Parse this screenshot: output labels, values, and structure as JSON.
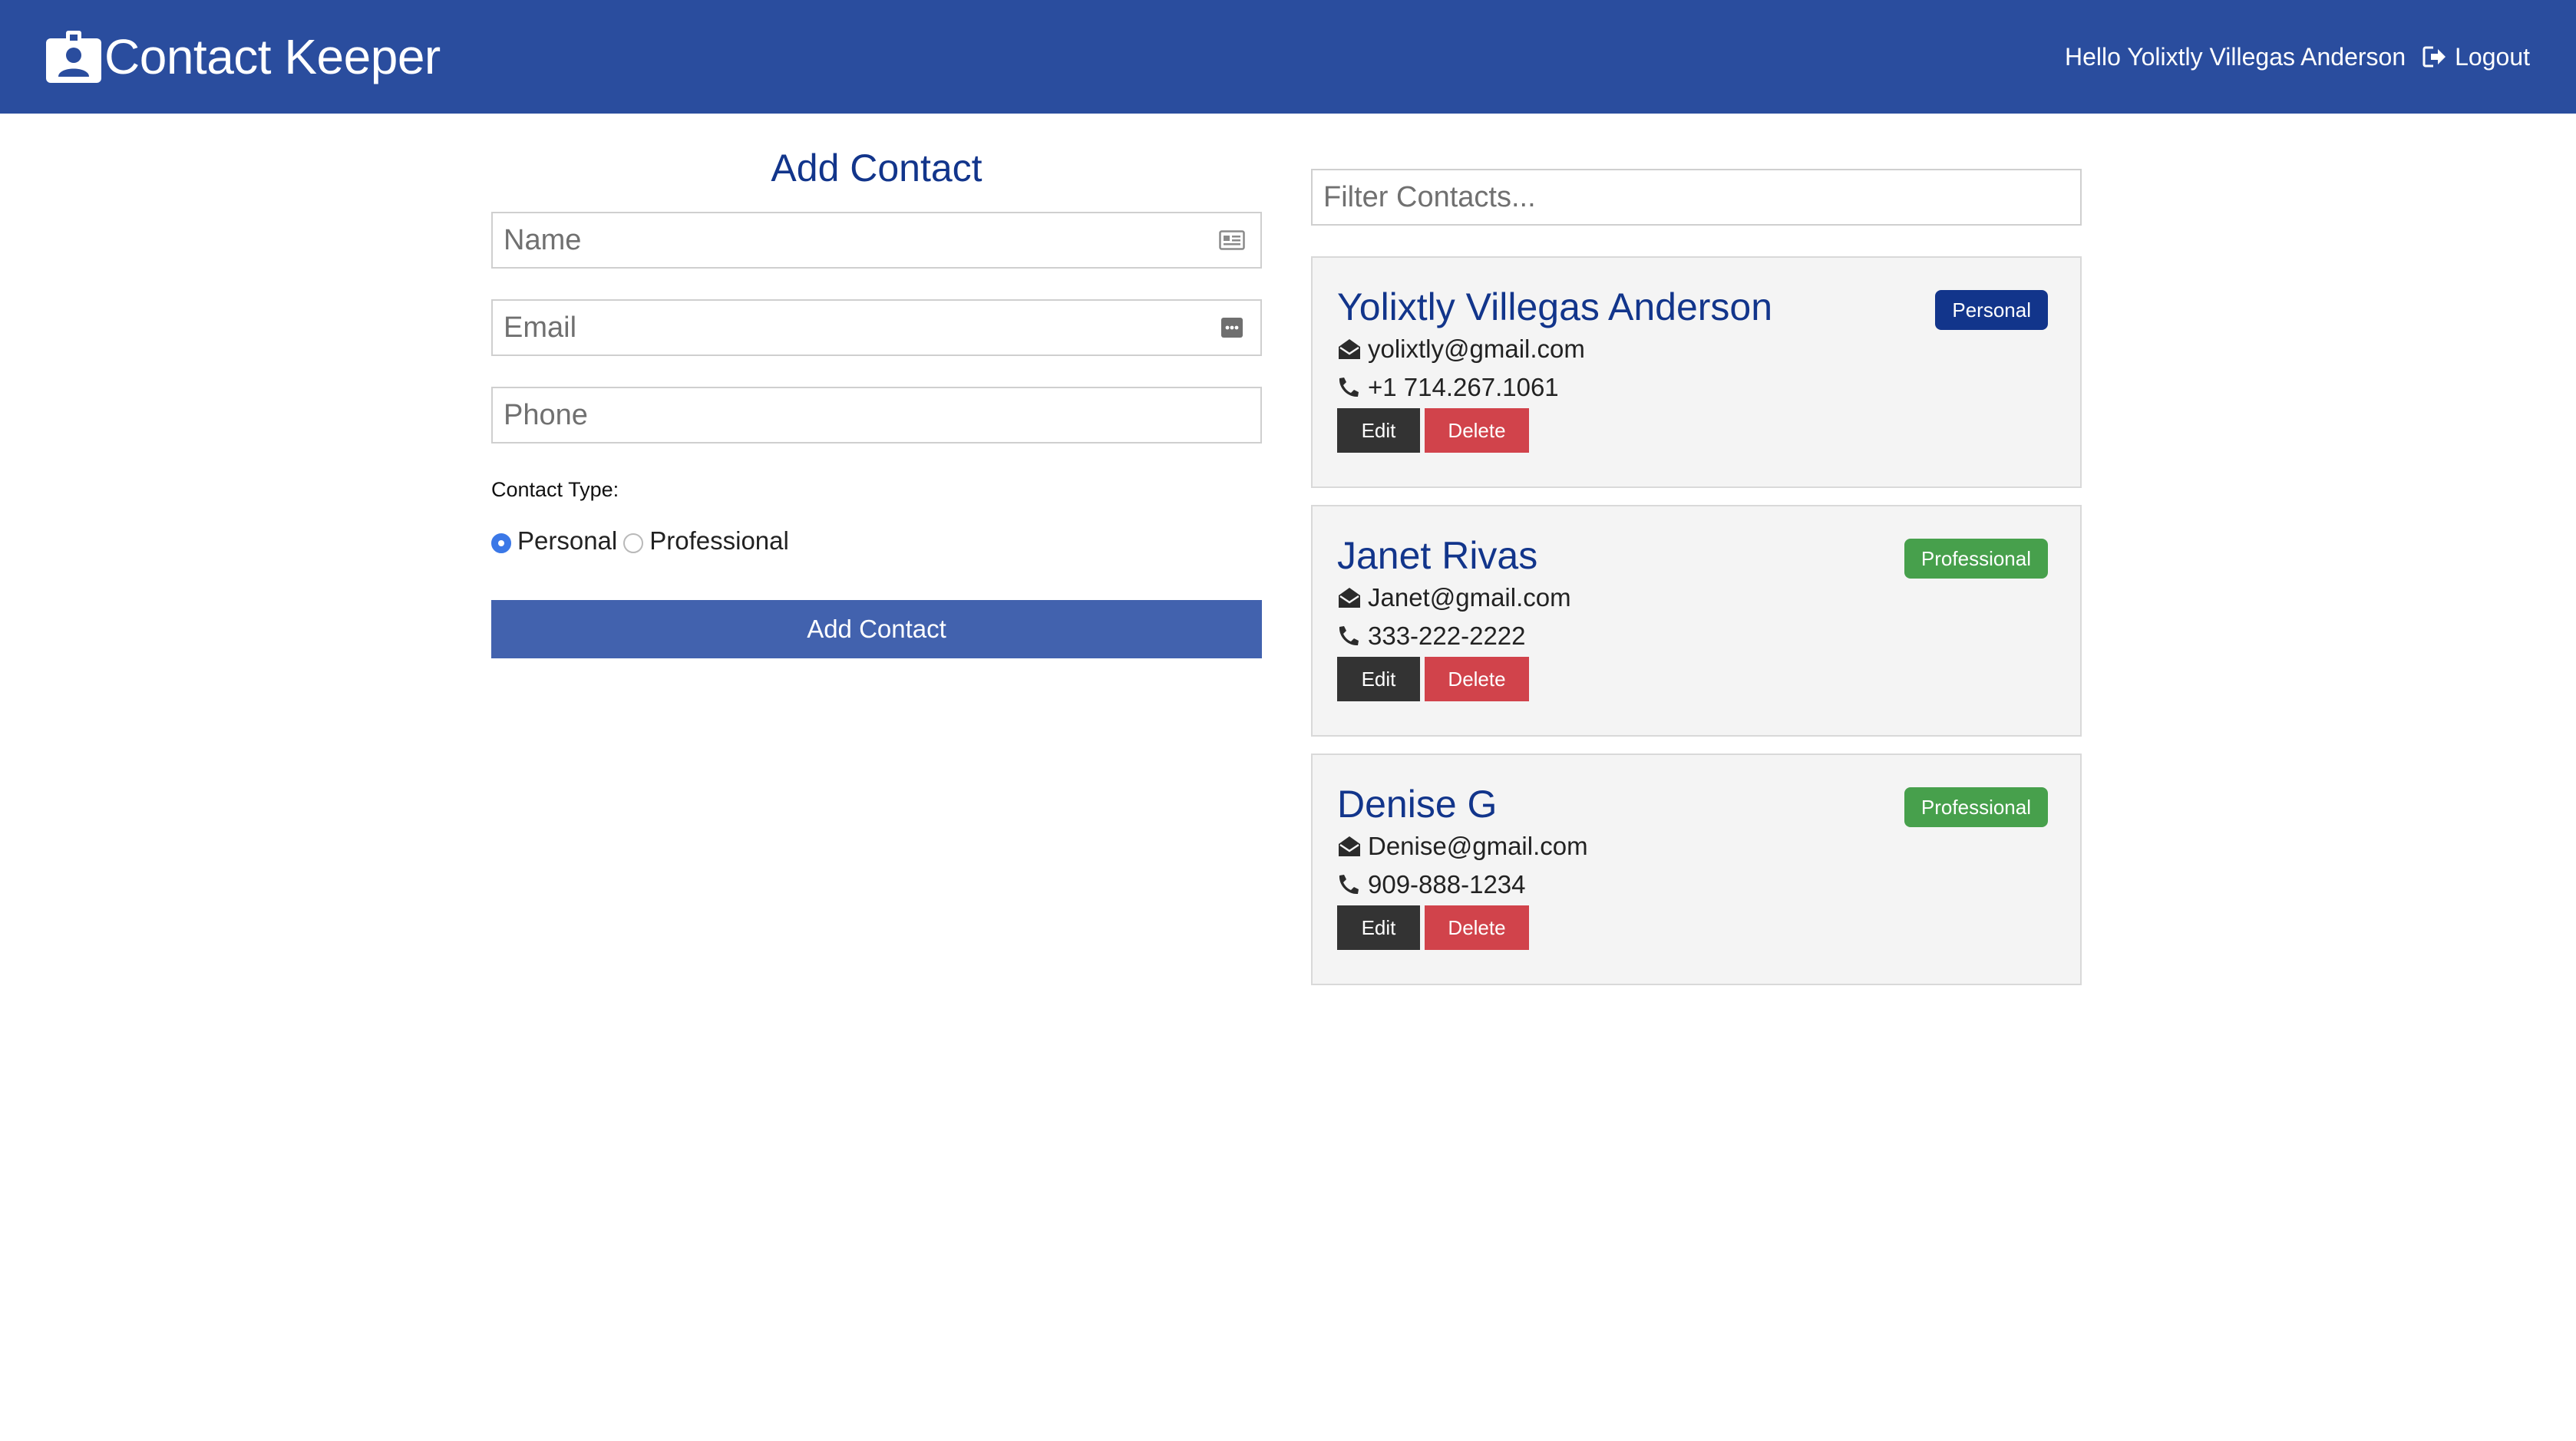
{
  "app": {
    "title": "Contact Keeper",
    "greeting": "Hello Yolixtly Villegas Anderson",
    "logout_label": "Logout"
  },
  "colors": {
    "navbar": "#2a4d9e",
    "primary_text": "#12358b",
    "personal_badge": "#12358b",
    "professional_badge": "#47a04c",
    "delete": "#d1434b",
    "edit": "#333333"
  },
  "icons": {
    "brand": "id-badge-icon",
    "logout": "sign-out-icon",
    "name_field": "id-card-icon",
    "email_field": "ellipsis-box-icon",
    "email_line": "envelope-open-icon",
    "phone_line": "phone-icon"
  },
  "form": {
    "title": "Add Contact",
    "name_placeholder": "Name",
    "email_placeholder": "Email",
    "phone_placeholder": "Phone",
    "name_value": "",
    "email_value": "",
    "phone_value": "",
    "type_label": "Contact Type:",
    "options": [
      "Personal",
      "Professional"
    ],
    "selected_option": "Personal",
    "submit_label": "Add Contact"
  },
  "filter": {
    "placeholder": "Filter Contacts..."
  },
  "contacts": [
    {
      "name": "Yolixtly Villegas Anderson",
      "type": "Personal",
      "email": "yolixtly@gmail.com",
      "phone": "+1 714.267.1061",
      "edit_label": "Edit",
      "delete_label": "Delete"
    },
    {
      "name": "Janet Rivas",
      "type": "Professional",
      "email": "Janet@gmail.com",
      "phone": "333-222-2222",
      "edit_label": "Edit",
      "delete_label": "Delete"
    },
    {
      "name": "Denise G",
      "type": "Professional",
      "email": "Denise@gmail.com",
      "phone": "909-888-1234",
      "edit_label": "Edit",
      "delete_label": "Delete"
    }
  ]
}
